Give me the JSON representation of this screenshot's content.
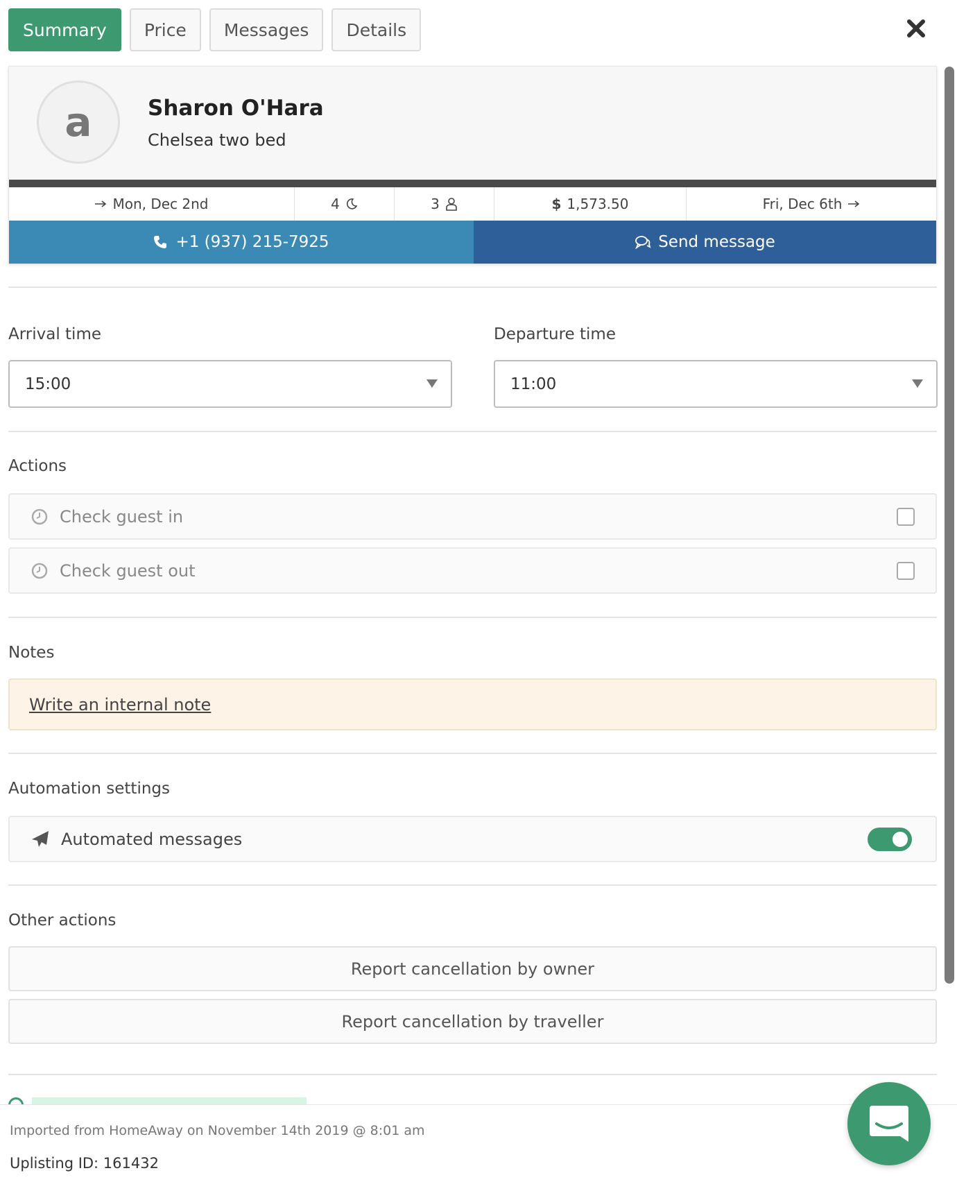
{
  "tabs": [
    {
      "label": "Summary",
      "active": true
    },
    {
      "label": "Price",
      "active": false
    },
    {
      "label": "Messages",
      "active": false
    },
    {
      "label": "Details",
      "active": false
    }
  ],
  "guest": {
    "avatar_letter": "a",
    "name": "Sharon O'Hara",
    "listing": "Chelsea two bed"
  },
  "stats": {
    "arrival": "Mon, Dec 2nd",
    "nights": "4",
    "guests": "3",
    "currency_symbol": "$",
    "total": "1,573.50",
    "departure": "Fri, Dec 6th"
  },
  "contact": {
    "phone": "+1 (937) 215-7925",
    "send_message_label": "Send message"
  },
  "times": {
    "arrival_label": "Arrival time",
    "arrival_value": "15:00",
    "departure_label": "Departure time",
    "departure_value": "11:00"
  },
  "actions": {
    "heading": "Actions",
    "items": [
      {
        "label": "Check guest in",
        "checked": false
      },
      {
        "label": "Check guest out",
        "checked": false
      }
    ]
  },
  "notes": {
    "heading": "Notes",
    "link_label": "Write an internal note"
  },
  "automation": {
    "heading": "Automation settings",
    "label": "Automated messages",
    "enabled": true
  },
  "other_actions": {
    "heading": "Other actions",
    "owner_cancel": "Report cancellation by owner",
    "traveller_cancel": "Report cancellation by traveller"
  },
  "footer": {
    "imported": "Imported from HomeAway on November 14th 2019 @ 8:01 am",
    "uplisting_id": "Uplisting ID: 161432"
  },
  "colors": {
    "accent_green": "#3d9970",
    "call_blue": "#3a8ab5",
    "message_blue": "#2e5f99",
    "note_bg": "#fdf4e7"
  },
  "icons": {
    "close": "close-icon",
    "arrow": "arrow-right-icon",
    "moon": "moon-icon",
    "user": "user-icon",
    "phone": "phone-icon",
    "chat": "chat-icon",
    "clock": "clock-icon",
    "plane": "paper-plane-icon",
    "support": "support-chat-icon"
  }
}
